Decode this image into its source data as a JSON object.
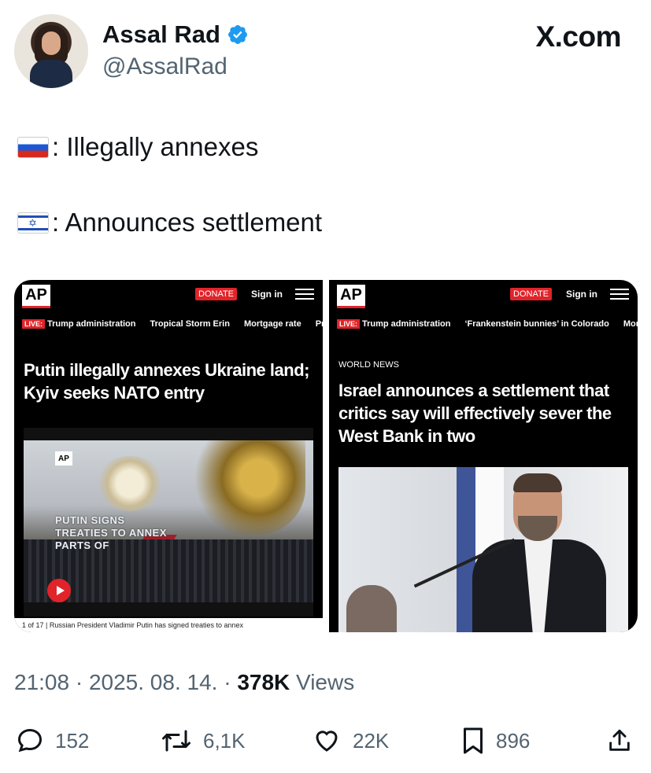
{
  "header": {
    "display_name": "Assal Rad",
    "handle": "@AssalRad",
    "brand": "X.com"
  },
  "tweet": {
    "lines": [
      {
        "flag": "russia-flag",
        "text": ": Illegally annexes"
      },
      {
        "flag": "israel-flag",
        "text": ": Announces settlement"
      }
    ]
  },
  "media": {
    "left": {
      "donate": "DONATE",
      "signin": "Sign in",
      "live": "LIVE:",
      "trends": [
        "Trump administration",
        "Tropical Storm Erin",
        "Mortgage rate",
        "Prod"
      ],
      "headline": "Putin illegally annexes Ukraine land; Kyiv seeks NATO entry",
      "overlay": "PUTIN SIGNS TREATIES TO ANNEX PARTS OF",
      "caption": "1 of 17 | Russian President Vladimir Putin has signed treaties to annex"
    },
    "right": {
      "donate": "DONATE",
      "signin": "Sign in",
      "live": "LIVE:",
      "trends": [
        "Trump administration",
        "‘Frankenstein bunnies’ in Colorado",
        "Mortgag"
      ],
      "kicker": "WORLD NEWS",
      "headline": "Israel announces a settlement that critics say will effectively sever the West Bank in two"
    },
    "ap_logo": "AP"
  },
  "meta": {
    "time": "21:08 · 2025. 08. 14. · ",
    "views_count": "378K",
    "views_label": " Views"
  },
  "actions": {
    "replies": "152",
    "reposts": "6,1K",
    "likes": "22K",
    "bookmarks": "896"
  },
  "colors": {
    "text": "#0f1419",
    "muted": "#536471",
    "verified": "#1d9bf0",
    "ap_red": "#e0242a"
  }
}
